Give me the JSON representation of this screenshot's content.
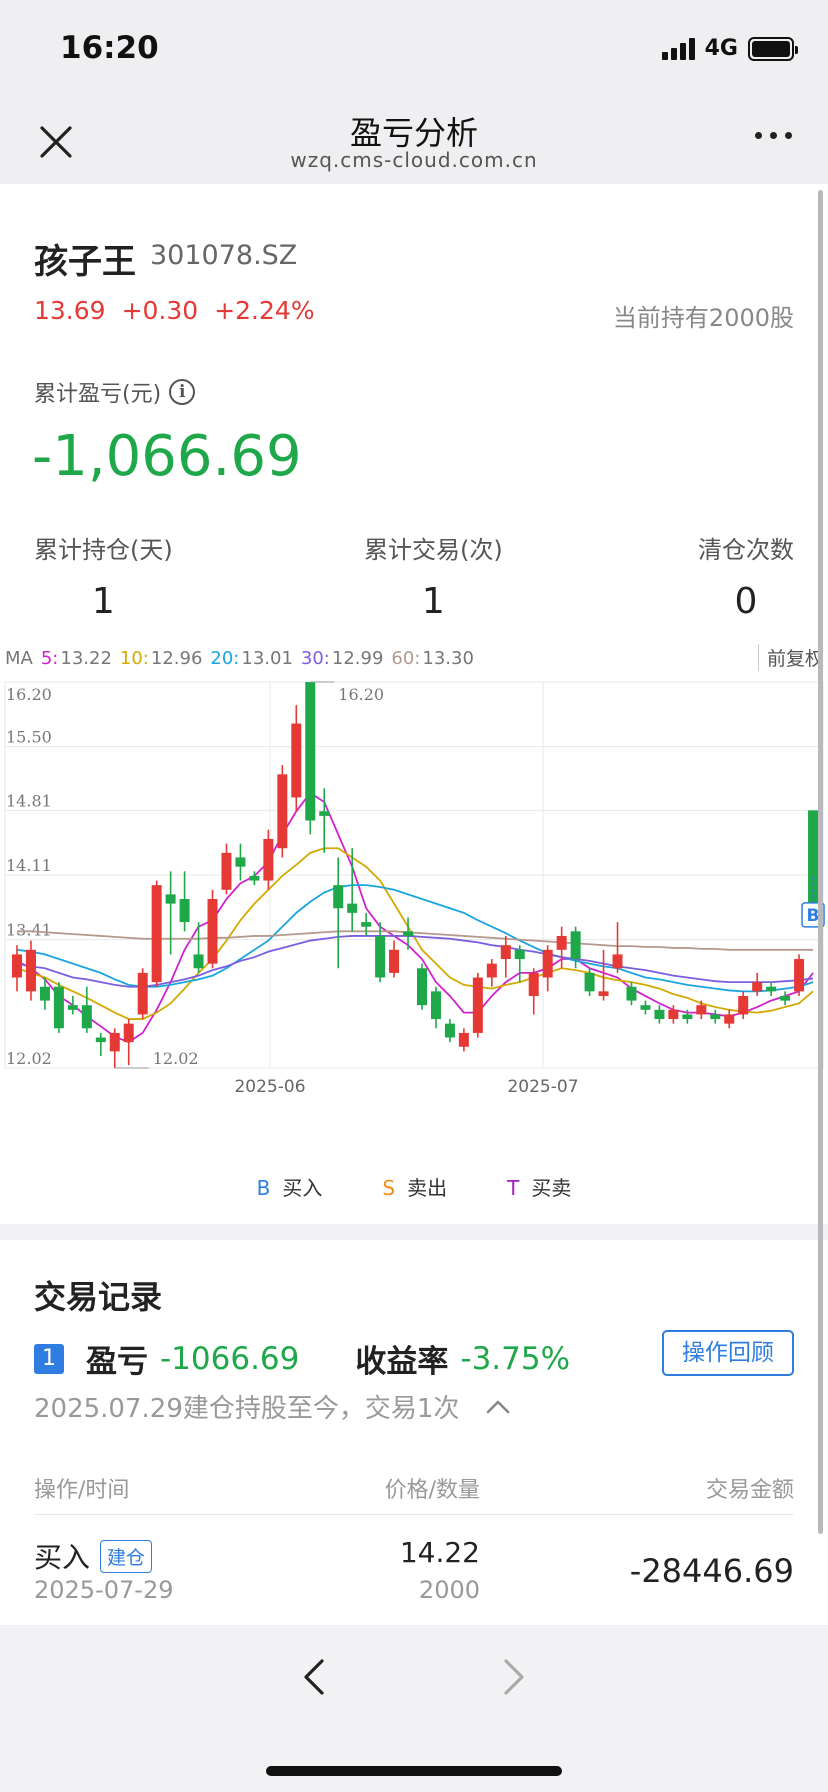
{
  "status": {
    "time": "16:20",
    "network": "4G"
  },
  "nav": {
    "title": "盈亏分析",
    "url": "wzq.cms-cloud.com.cn"
  },
  "stock": {
    "name": "孩子王",
    "code": "301078.SZ",
    "price": "13.69",
    "change": "+0.30",
    "change_pct": "+2.24%",
    "holding": "当前持有2000股"
  },
  "pl": {
    "label": "累计盈亏(元)",
    "info_icon": "i",
    "value": "-1,066.69"
  },
  "stats": [
    {
      "label": "累计持仓(天)",
      "value": "1"
    },
    {
      "label": "累计交易(次)",
      "value": "1"
    },
    {
      "label": "清仓次数",
      "value": "0"
    }
  ],
  "ma": {
    "prefix": "MA",
    "items": [
      {
        "key": "5:",
        "value": "13.22",
        "color": "#d021d0"
      },
      {
        "key": "10:",
        "value": "12.96",
        "color": "#d4a900"
      },
      {
        "key": "20:",
        "value": "13.01",
        "color": "#1aa5e0"
      },
      {
        "key": "30:",
        "value": "12.99",
        "color": "#7b5de0"
      },
      {
        "key": "60:",
        "value": "13.30",
        "color": "#b49a8c"
      }
    ],
    "adjust": "前复权"
  },
  "chart_data": {
    "type": "candlestick",
    "y_ticks": [
      "16.20",
      "15.50",
      "14.81",
      "14.11",
      "13.41",
      "12.02"
    ],
    "ylim": [
      12.02,
      16.2
    ],
    "x_ticks": [
      "2025-06",
      "2025-07"
    ],
    "high_label": "16.20",
    "low_label": "12.02",
    "trade_marker": "B",
    "candles": [
      {
        "o": 13.0,
        "c": 13.25,
        "h": 13.35,
        "l": 12.85
      },
      {
        "o": 12.85,
        "c": 13.3,
        "h": 13.4,
        "l": 12.75
      },
      {
        "o": 12.9,
        "c": 12.75,
        "h": 13.0,
        "l": 12.65
      },
      {
        "o": 12.9,
        "c": 12.45,
        "h": 12.95,
        "l": 12.4
      },
      {
        "o": 12.7,
        "c": 12.65,
        "h": 12.8,
        "l": 12.6
      },
      {
        "o": 12.7,
        "c": 12.45,
        "h": 12.9,
        "l": 12.4
      },
      {
        "o": 12.35,
        "c": 12.3,
        "h": 12.4,
        "l": 12.15
      },
      {
        "o": 12.2,
        "c": 12.4,
        "h": 12.45,
        "l": 12.02
      },
      {
        "o": 12.3,
        "c": 12.5,
        "h": 12.55,
        "l": 12.05
      },
      {
        "o": 12.6,
        "c": 13.05,
        "h": 13.1,
        "l": 12.55
      },
      {
        "o": 12.95,
        "c": 14.0,
        "h": 14.05,
        "l": 12.9
      },
      {
        "o": 13.9,
        "c": 13.8,
        "h": 14.15,
        "l": 13.25
      },
      {
        "o": 13.85,
        "c": 13.6,
        "h": 14.15,
        "l": 13.5
      },
      {
        "o": 13.25,
        "c": 13.1,
        "h": 13.6,
        "l": 13.05
      },
      {
        "o": 13.15,
        "c": 13.85,
        "h": 13.95,
        "l": 13.1
      },
      {
        "o": 13.95,
        "c": 14.35,
        "h": 14.45,
        "l": 13.9
      },
      {
        "o": 14.3,
        "c": 14.2,
        "h": 14.45,
        "l": 14.05
      },
      {
        "o": 14.1,
        "c": 14.05,
        "h": 14.15,
        "l": 14.0
      },
      {
        "o": 14.05,
        "c": 14.5,
        "h": 14.6,
        "l": 13.95
      },
      {
        "o": 14.4,
        "c": 15.2,
        "h": 15.3,
        "l": 14.3
      },
      {
        "o": 14.95,
        "c": 15.75,
        "h": 15.95,
        "l": 14.8
      },
      {
        "o": 16.2,
        "c": 14.7,
        "h": 16.2,
        "l": 14.55
      },
      {
        "o": 14.8,
        "c": 14.75,
        "h": 15.05,
        "l": 14.35
      },
      {
        "o": 14.0,
        "c": 13.75,
        "h": 14.3,
        "l": 13.1
      },
      {
        "o": 13.8,
        "c": 13.7,
        "h": 14.4,
        "l": 13.5
      },
      {
        "o": 13.6,
        "c": 13.55,
        "h": 13.7,
        "l": 13.45
      },
      {
        "o": 13.45,
        "c": 13.0,
        "h": 13.6,
        "l": 12.95
      },
      {
        "o": 13.05,
        "c": 13.3,
        "h": 13.4,
        "l": 13.0
      },
      {
        "o": 13.5,
        "c": 13.45,
        "h": 13.65,
        "l": 13.3
      },
      {
        "o": 13.1,
        "c": 12.7,
        "h": 13.15,
        "l": 12.65
      },
      {
        "o": 12.85,
        "c": 12.55,
        "h": 12.9,
        "l": 12.45
      },
      {
        "o": 12.5,
        "c": 12.35,
        "h": 12.55,
        "l": 12.3
      },
      {
        "o": 12.25,
        "c": 12.4,
        "h": 12.45,
        "l": 12.2
      },
      {
        "o": 12.4,
        "c": 13.0,
        "h": 13.05,
        "l": 12.35
      },
      {
        "o": 13.0,
        "c": 13.15,
        "h": 13.2,
        "l": 12.9
      },
      {
        "o": 13.2,
        "c": 13.35,
        "h": 13.45,
        "l": 13.0
      },
      {
        "o": 13.3,
        "c": 13.2,
        "h": 13.35,
        "l": 12.95
      },
      {
        "o": 12.8,
        "c": 13.05,
        "h": 13.1,
        "l": 12.6
      },
      {
        "o": 13.0,
        "c": 13.3,
        "h": 13.35,
        "l": 12.85
      },
      {
        "o": 13.3,
        "c": 13.45,
        "h": 13.55,
        "l": 13.1
      },
      {
        "o": 13.5,
        "c": 13.2,
        "h": 13.55,
        "l": 13.1
      },
      {
        "o": 13.05,
        "c": 12.85,
        "h": 13.1,
        "l": 12.8
      },
      {
        "o": 12.8,
        "c": 12.85,
        "h": 13.3,
        "l": 12.75
      },
      {
        "o": 13.1,
        "c": 13.25,
        "h": 13.6,
        "l": 13.05
      },
      {
        "o": 12.9,
        "c": 12.75,
        "h": 12.95,
        "l": 12.7
      },
      {
        "o": 12.7,
        "c": 12.65,
        "h": 12.75,
        "l": 12.6
      },
      {
        "o": 12.65,
        "c": 12.55,
        "h": 12.7,
        "l": 12.5
      },
      {
        "o": 12.55,
        "c": 12.65,
        "h": 12.7,
        "l": 12.5
      },
      {
        "o": 12.6,
        "c": 12.55,
        "h": 12.65,
        "l": 12.5
      },
      {
        "o": 12.6,
        "c": 12.7,
        "h": 12.75,
        "l": 12.55
      },
      {
        "o": 12.6,
        "c": 12.55,
        "h": 12.65,
        "l": 12.5
      },
      {
        "o": 12.5,
        "c": 12.6,
        "h": 12.65,
        "l": 12.45
      },
      {
        "o": 12.6,
        "c": 12.8,
        "h": 12.85,
        "l": 12.55
      },
      {
        "o": 12.85,
        "c": 12.95,
        "h": 13.05,
        "l": 12.8
      },
      {
        "o": 12.9,
        "c": 12.85,
        "h": 12.95,
        "l": 12.8
      },
      {
        "o": 12.8,
        "c": 12.75,
        "h": 12.85,
        "l": 12.7
      },
      {
        "o": 12.85,
        "c": 13.2,
        "h": 13.25,
        "l": 12.8
      },
      {
        "o": 14.81,
        "c": 13.7,
        "h": 14.81,
        "l": 13.6
      }
    ],
    "series": [
      {
        "name": "5",
        "color": "#d021d0",
        "values": [
          13.18,
          13.1,
          12.98,
          12.8,
          12.7,
          12.58,
          12.47,
          12.36,
          12.3,
          12.4,
          12.65,
          12.95,
          13.3,
          13.55,
          13.62,
          13.85,
          14.02,
          14.1,
          14.25,
          14.55,
          14.8,
          15.0,
          14.9,
          14.55,
          14.2,
          13.75,
          13.55,
          13.45,
          13.35,
          13.2,
          12.95,
          12.8,
          12.62,
          12.62,
          12.8,
          12.95,
          13.05,
          13.05,
          13.1,
          13.2,
          13.2,
          13.1,
          13.05,
          13.0,
          12.88,
          12.8,
          12.72,
          12.65,
          12.62,
          12.62,
          12.6,
          12.58,
          12.62,
          12.68,
          12.75,
          12.8,
          12.85,
          13.05
        ]
      },
      {
        "name": "10",
        "color": "#d4a900",
        "values": [
          13.1,
          13.05,
          13.0,
          12.92,
          12.85,
          12.78,
          12.7,
          12.62,
          12.55,
          12.55,
          12.62,
          12.72,
          12.88,
          13.05,
          13.2,
          13.4,
          13.62,
          13.8,
          13.95,
          14.1,
          14.22,
          14.35,
          14.4,
          14.4,
          14.3,
          14.2,
          14.05,
          13.8,
          13.55,
          13.3,
          13.15,
          13.0,
          12.92,
          12.9,
          12.88,
          12.92,
          12.95,
          13.0,
          13.05,
          13.1,
          13.08,
          13.05,
          13.0,
          12.97,
          12.95,
          12.92,
          12.88,
          12.82,
          12.78,
          12.72,
          12.68,
          12.65,
          12.63,
          12.62,
          12.64,
          12.68,
          12.72,
          12.85
        ]
      },
      {
        "name": "20",
        "color": "#1aa5e0",
        "values": [
          13.3,
          13.28,
          13.25,
          13.2,
          13.15,
          13.1,
          13.05,
          12.98,
          12.92,
          12.9,
          12.9,
          12.92,
          12.95,
          12.98,
          13.02,
          13.1,
          13.2,
          13.3,
          13.4,
          13.55,
          13.7,
          13.82,
          13.92,
          13.98,
          14.0,
          14.0,
          13.98,
          13.95,
          13.9,
          13.85,
          13.8,
          13.75,
          13.7,
          13.62,
          13.55,
          13.48,
          13.4,
          13.33,
          13.26,
          13.22,
          13.18,
          13.15,
          13.12,
          13.1,
          13.05,
          13.0,
          12.98,
          12.95,
          12.92,
          12.9,
          12.88,
          12.86,
          12.85,
          12.85,
          12.86,
          12.88,
          12.9,
          12.95
        ]
      },
      {
        "name": "30",
        "color": "#7b5de0",
        "values": [
          13.15,
          13.12,
          13.1,
          13.05,
          13.0,
          12.98,
          12.95,
          12.92,
          12.9,
          12.9,
          12.92,
          12.95,
          12.98,
          13.02,
          13.08,
          13.12,
          13.18,
          13.22,
          13.28,
          13.32,
          13.36,
          13.4,
          13.42,
          13.44,
          13.45,
          13.45,
          13.45,
          13.45,
          13.45,
          13.44,
          13.43,
          13.42,
          13.4,
          13.38,
          13.35,
          13.33,
          13.3,
          13.28,
          13.25,
          13.22,
          13.2,
          13.18,
          13.15,
          13.12,
          13.1,
          13.08,
          13.05,
          13.02,
          13.0,
          12.98,
          12.96,
          12.95,
          12.95,
          12.95,
          12.95,
          12.96,
          12.97,
          12.99
        ]
      },
      {
        "name": "60",
        "color": "#b49a8c",
        "values": [
          13.5,
          13.5,
          13.49,
          13.48,
          13.47,
          13.46,
          13.45,
          13.44,
          13.43,
          13.42,
          13.42,
          13.42,
          13.42,
          13.42,
          13.43,
          13.43,
          13.44,
          13.45,
          13.45,
          13.46,
          13.47,
          13.48,
          13.49,
          13.5,
          13.5,
          13.5,
          13.5,
          13.5,
          13.49,
          13.48,
          13.47,
          13.46,
          13.45,
          13.44,
          13.43,
          13.42,
          13.41,
          13.4,
          13.39,
          13.38,
          13.37,
          13.36,
          13.35,
          13.34,
          13.34,
          13.33,
          13.33,
          13.32,
          13.32,
          13.31,
          13.31,
          13.3,
          13.3,
          13.3,
          13.3,
          13.3,
          13.3,
          13.3
        ]
      }
    ]
  },
  "legend": [
    {
      "key": "B",
      "label": "买入",
      "color": "#2f7de1"
    },
    {
      "key": "S",
      "label": "卖出",
      "color": "#f08c1a"
    },
    {
      "key": "T",
      "label": "买卖",
      "color": "#a020c0"
    }
  ],
  "trade": {
    "title": "交易记录",
    "record_no": "1",
    "pl_label": "盈亏",
    "pl_value": "-1066.69",
    "rate_label": "收益率",
    "rate_value": "-3.75%",
    "review_button": "操作回顾",
    "desc": "2025.07.29建仓持股至今，交易1次",
    "columns": {
      "op_time": "操作/时间",
      "price_qty": "价格/数量",
      "amount": "交易金额"
    },
    "row": {
      "op": "买入",
      "tag": "建仓",
      "date": "2025-07-29",
      "price": "14.22",
      "qty": "2000",
      "amount": "-28446.69"
    }
  },
  "colors": {
    "up": "#e53935",
    "down": "#1fa84a",
    "accent": "#2f7de1"
  }
}
